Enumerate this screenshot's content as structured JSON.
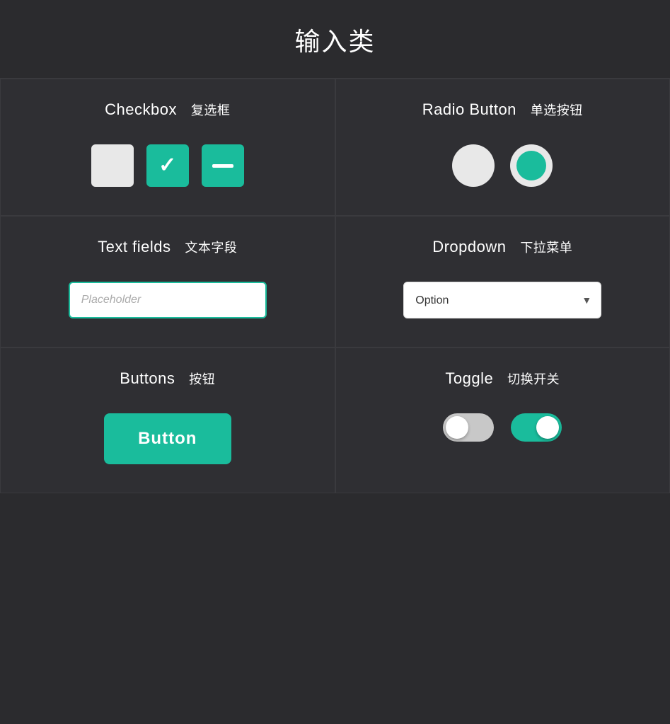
{
  "header": {
    "title": "输入类"
  },
  "cells": {
    "checkbox": {
      "title_en": "Checkbox",
      "title_zh": "复选框",
      "states": [
        "empty",
        "checked",
        "indeterminate"
      ]
    },
    "radio": {
      "title_en": "Radio Button",
      "title_zh": "单选按钮",
      "states": [
        "unselected",
        "selected"
      ]
    },
    "textfield": {
      "title_en": "Text fields",
      "title_zh": "文本字段",
      "placeholder": "Placeholder"
    },
    "dropdown": {
      "title_en": "Dropdown",
      "title_zh": "下拉菜单",
      "option_label": "Option"
    },
    "buttons": {
      "title_en": "Buttons",
      "title_zh": "按钮",
      "button_label": "Button"
    },
    "toggle": {
      "title_en": "Toggle",
      "title_zh": "切换开关",
      "states": [
        "off",
        "on"
      ]
    }
  },
  "colors": {
    "accent": "#1abc9c",
    "bg": "#2b2b2e",
    "cell_bg": "#2f2f33",
    "white": "#ffffff",
    "light_gray": "#e8e8e8"
  }
}
